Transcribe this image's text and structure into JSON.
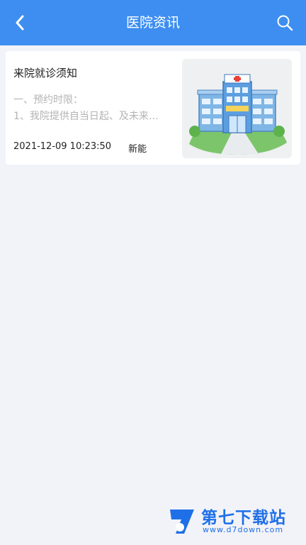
{
  "header": {
    "title": "医院资讯",
    "back_icon": "chevron-left-icon",
    "search_icon": "search-icon"
  },
  "articles": [
    {
      "title": "来院就诊须知",
      "summary_lines": [
        "一、预约时限：",
        "1、我院提供自当日起、及未来…"
      ],
      "datetime": "2021-12-09 10:23:50",
      "author": "新能",
      "thumbnail_icon": "hospital-icon"
    }
  ],
  "watermark": {
    "title": "第七下载站",
    "site": "www.d7down.com"
  },
  "colors": {
    "header": "#3d8ef0",
    "background": "#f2f3f8",
    "watermark": "#1e6fe8"
  }
}
